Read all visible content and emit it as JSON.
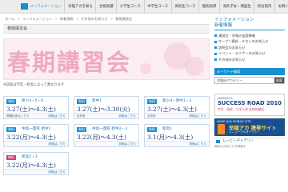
{
  "nav": {
    "items": [
      "インフォメーション",
      "早稲アカを知る",
      "合格実績",
      "小学生コース",
      "中学生コース",
      "高校生コース",
      "個別指導",
      "海外子女・帰国生",
      "校舎案内",
      "お問い合わせ"
    ],
    "active_index": 0
  },
  "breadcrumb": [
    "ホーム",
    "インフォメーション",
    "新着情報",
    "その他のお知らせ",
    "春期講習会"
  ],
  "section_title": "春期講習会",
  "hero": {
    "title": "春期講習会",
    "note": "※日程は学年・校舎によって異なります"
  },
  "courses": [
    {
      "badge": "有料",
      "free": false,
      "name": "新小4・5・6",
      "dates": "3.27(土)～4.3(土)",
      "foot": "開講校舎はこちら",
      "link": "詳細はこちら"
    },
    {
      "badge": "有料",
      "free": false,
      "name": "新中1",
      "dates": "3.27(土)～3.30(火)",
      "foot": "全校舎",
      "link": "詳細はこちら"
    },
    {
      "badge": "有料",
      "free": false,
      "name": "新小4・新中1・3",
      "dates": "3.27(土)～4.3(土)",
      "foot": "全校舎",
      "link": "詳細はこちら"
    },
    {
      "badge": "有料",
      "free": false,
      "name": "中高一貫校 新中1",
      "dates": "3.22(月)～4.3(土)",
      "foot": "",
      "link": "詳細はこちら"
    },
    {
      "badge": "有料",
      "free": false,
      "name": "中高一貫校 新中2・3",
      "dates": "3.22(月)～4.3(土)",
      "foot": "",
      "link": "詳細はこちら"
    },
    {
      "badge": "有料",
      "free": false,
      "name": "新高1",
      "dates": "3.1(月)～4.3(土)",
      "foot": "",
      "link": "詳細はこちら"
    },
    {
      "badge": "無料",
      "free": true,
      "name": "新高2・3",
      "dates": "3.22(月)～4.3(土)",
      "foot": "",
      "link": "詳細はこちら"
    }
  ],
  "sidebar": {
    "title_line1": "インフォメーション",
    "title_line2": "新着情報",
    "items": [
      "講習会・合格の出版情報",
      "オープン模試・テストのお知らせ",
      "説明会のお知らせ",
      "イベント・セミナーのお知らせ",
      "その他のお知らせ"
    ],
    "keyword_label": "キーワード検索",
    "keyword_value": "早稲田アカデミー",
    "keyword_button": "検索",
    "banner1": {
      "top": "WASEACA",
      "main": "SUCCESS ROAD 2010",
      "sub": "中学・高校・大学入試 合格体験記"
    },
    "banner2": {
      "top": "WASE-ACA MOBILE SITE",
      "main": "早稲アカ 携帯サイト",
      "sub": "リニューアルオープン!"
    },
    "gallery_label": "ムービーギャラリー",
    "footer_note": "最新のお知らせを掲載中"
  }
}
